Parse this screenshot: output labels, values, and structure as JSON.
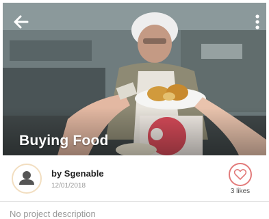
{
  "hero": {
    "title": "Buying Food"
  },
  "author": {
    "byline": "by Sgenable",
    "date": "12/01/2018"
  },
  "likes": {
    "label": "3 likes"
  },
  "description": "No project description",
  "colors": {
    "avatar_border": "#f2dec0",
    "heart": "#e27a7a",
    "background": "#ffffff",
    "hero_title": "#ffffff"
  },
  "icons": [
    "back-arrow-icon",
    "more-vertical-icon",
    "user-icon",
    "heart-icon"
  ]
}
